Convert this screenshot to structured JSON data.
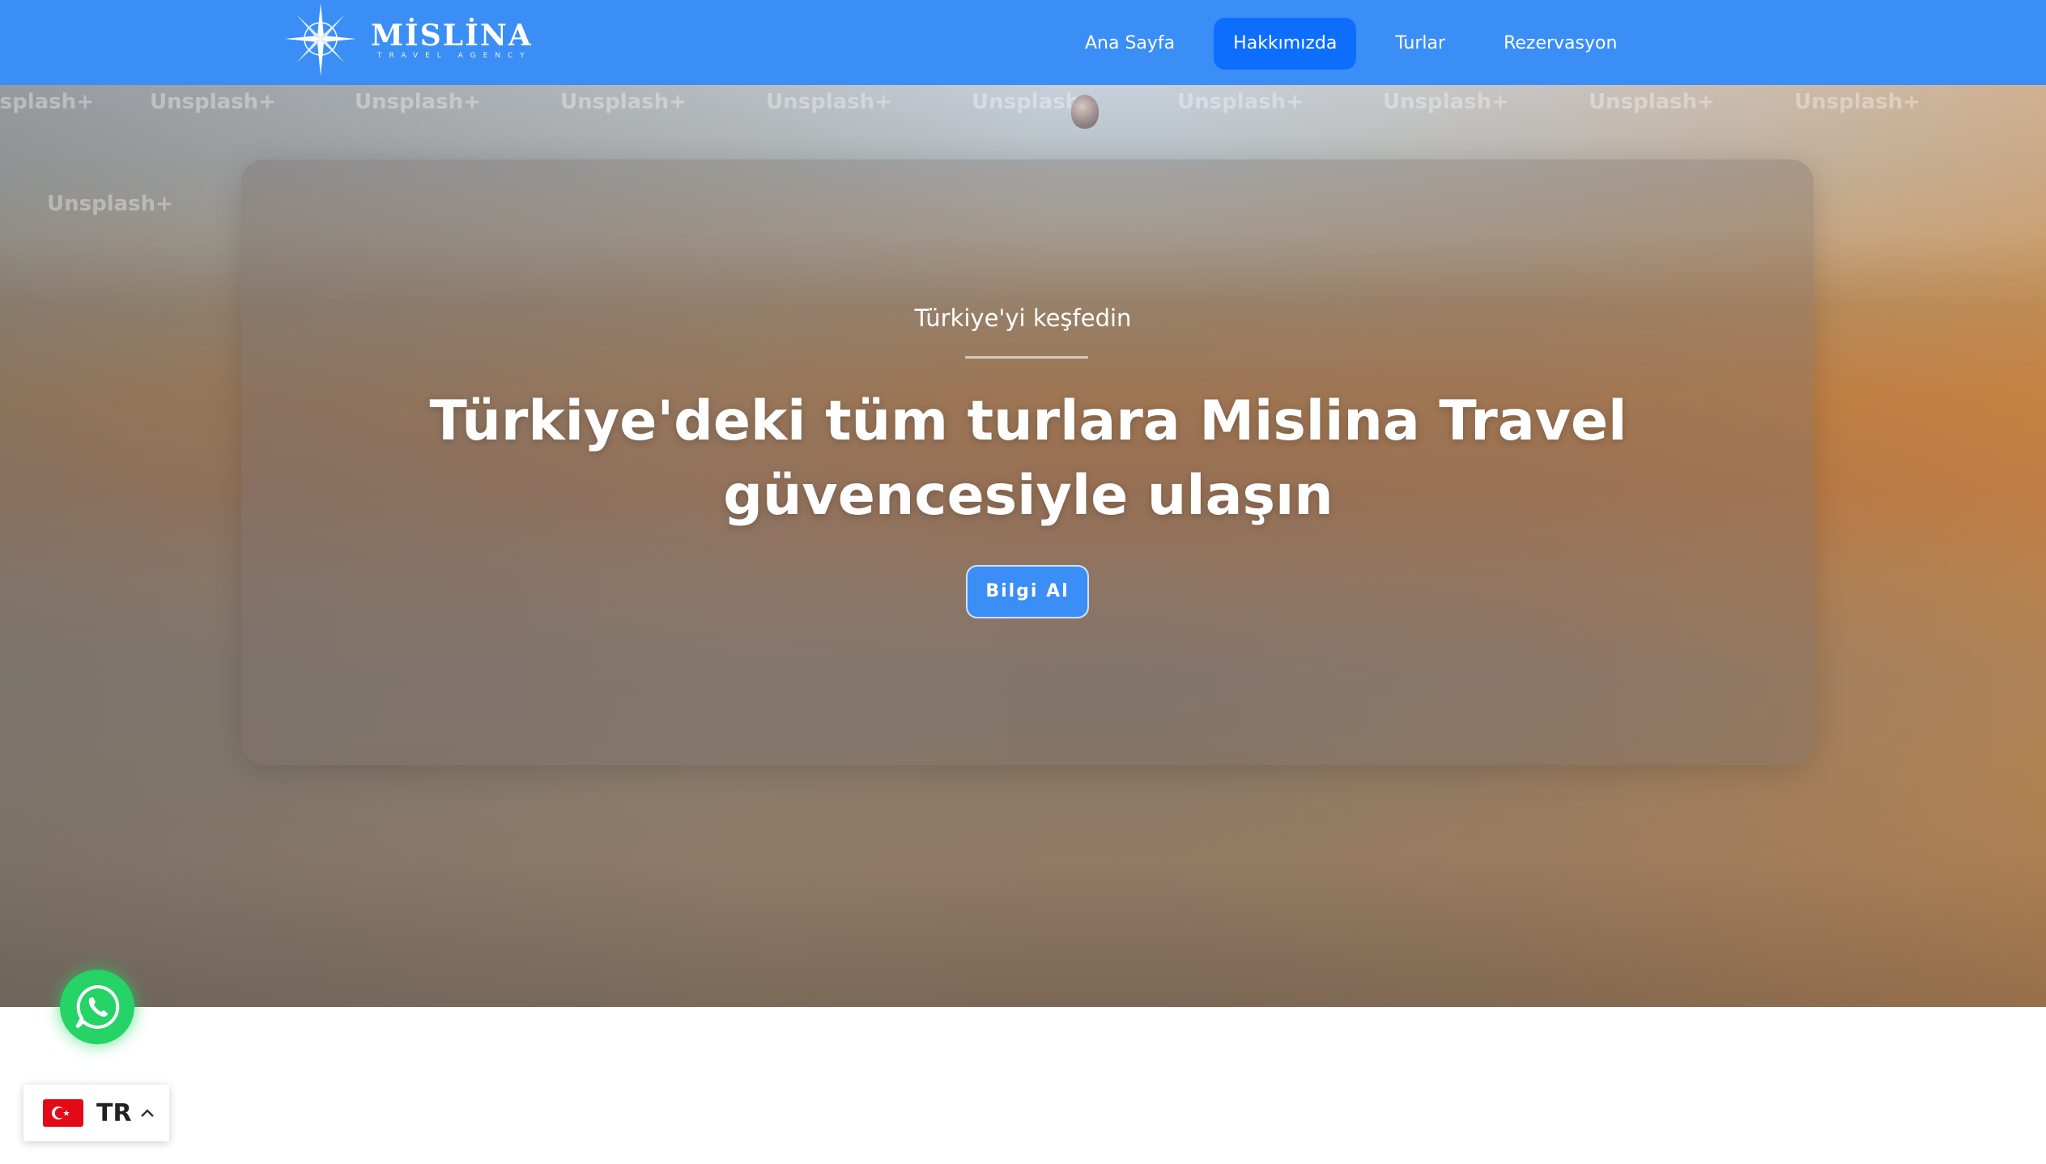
{
  "brand": {
    "name": "MİSLİNA",
    "subtitle": "TRAVEL AGENCY"
  },
  "nav": {
    "items": [
      {
        "label": "Ana Sayfa",
        "active": false
      },
      {
        "label": "Hakkımızda",
        "active": true
      },
      {
        "label": "Turlar",
        "active": false
      },
      {
        "label": "Rezervasyon",
        "active": false
      }
    ]
  },
  "hero": {
    "watermark": "Unsplash+",
    "kicker": "Türkiye'yi keşfedin",
    "title": "Türkiye'deki tüm turlara Mislina Travel güvencesiyle ulaşın",
    "cta_label": "Bilgi Al"
  },
  "language": {
    "code": "TR"
  },
  "colors": {
    "navbar": "#3a8ef6",
    "active_nav": "#0d6efd",
    "whatsapp": "#25d366",
    "flag_red": "#e30a17"
  },
  "icons": [
    "compass-logo-icon",
    "whatsapp-icon",
    "turkey-flag-icon",
    "chevron-up-icon"
  ]
}
